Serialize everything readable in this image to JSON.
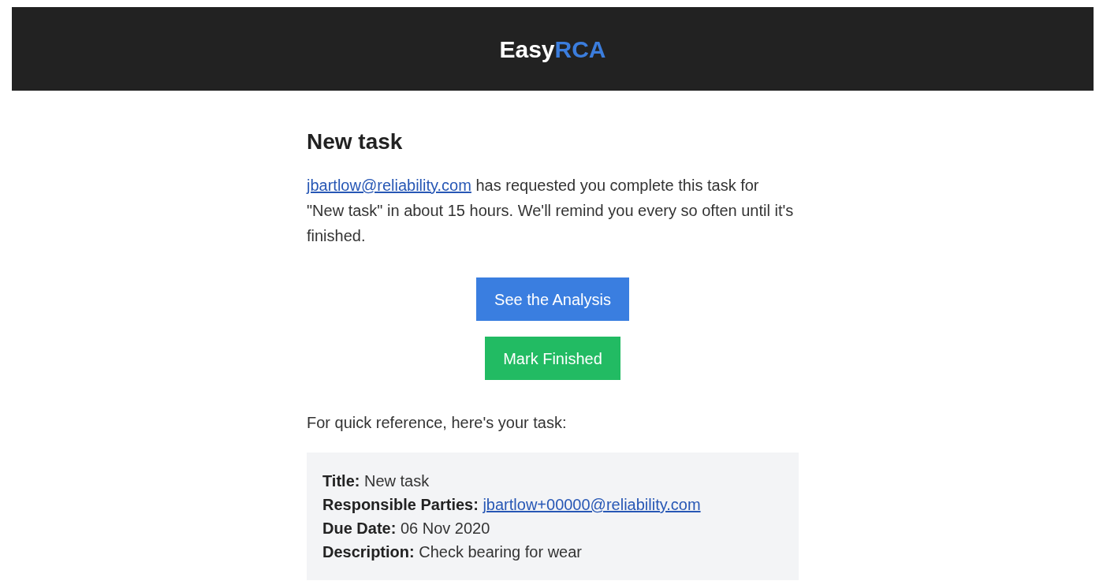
{
  "header": {
    "logo": {
      "text": "Easy",
      "accent": "RCA"
    }
  },
  "email": {
    "heading": "New task",
    "intro": {
      "link": "jbartlow@reliability.com",
      "text": " has requested you complete this task for \"New task\" in about 15 hours. We'll remind you every so often until it's finished."
    },
    "buttons": [
      {
        "label": "See the Analysis",
        "kind": "primary"
      },
      {
        "label": "Mark Finished",
        "kind": "success"
      }
    ],
    "reference_note": "For quick reference, here's your task:",
    "task_details": [
      {
        "label": "Title:",
        "value": "New task",
        "kind": "text"
      },
      {
        "label": "Responsible Parties:",
        "value": "jbartlow+00000@reliability.com",
        "kind": "link"
      },
      {
        "label": "Due Date:",
        "value": "06 Nov 2020",
        "kind": "text"
      },
      {
        "label": "Description:",
        "value": "Check bearing for wear",
        "kind": "text"
      }
    ]
  }
}
